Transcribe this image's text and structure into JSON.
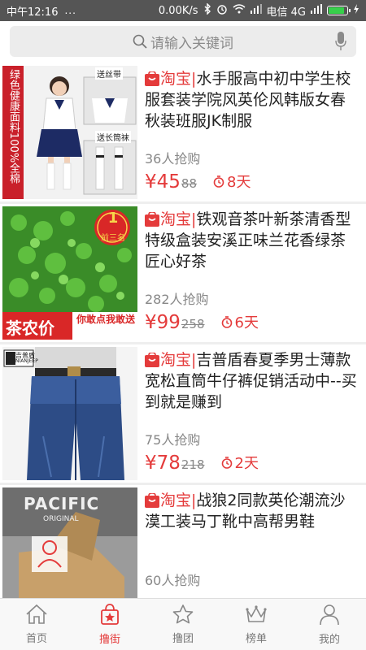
{
  "status_bar": {
    "time": "中午12:16",
    "dots": "...",
    "speed": "0.00K/s",
    "carrier": "电信 4G",
    "battery_level": 0.9
  },
  "search": {
    "placeholder": "请输入关键词"
  },
  "tb_label": "淘宝",
  "products": [
    {
      "title": "水手服高中初中学生校服套装学院风英伦风韩版女春秋装班服JK制服",
      "sold": "36人抢购",
      "price": "¥45",
      "original_price": "88",
      "days_left": "8天",
      "thumb": {
        "side_text": "绿色健康面料100%全棉",
        "tag1": "送丝带",
        "tag2": "送长筒袜"
      }
    },
    {
      "title": "铁观音茶叶新茶清香型特级盒装安溪正味兰花香绿茶匠心好茶",
      "sold": "282人抢购",
      "price": "¥99",
      "original_price": "258",
      "days_left": "6天",
      "thumb": {
        "medal_num": "1",
        "medal_text": "前三名",
        "banner": "茶农价",
        "banner_tag": "你敢点我敢送"
      }
    },
    {
      "title": "吉普盾春夏季男士薄款宽松直筒牛仔裤促销活动中--买到就是赚到",
      "sold": "75人抢购",
      "price": "¥78",
      "original_price": "218",
      "days_left": "2天",
      "thumb": {
        "brand_cn": "吉普盾",
        "brand_en": "NIANJEEP"
      }
    },
    {
      "title": "战狼2同款英伦潮流沙漠工装马丁靴中高帮男鞋",
      "sold": "60人抢购",
      "price": "",
      "original_price": "",
      "days_left": "",
      "thumb": {
        "brand": "PACIFIC",
        "sub": "ORIGINAL"
      }
    }
  ],
  "nav": [
    {
      "label": "首页",
      "icon": "home-icon"
    },
    {
      "label": "撸街",
      "icon": "shopping-bag-icon",
      "active": true
    },
    {
      "label": "撸团",
      "icon": "star-icon"
    },
    {
      "label": "榜单",
      "icon": "crown-icon"
    },
    {
      "label": "我的",
      "icon": "user-icon"
    }
  ],
  "colors": {
    "accent": "#e43b3b",
    "status_bar": "#555555"
  }
}
